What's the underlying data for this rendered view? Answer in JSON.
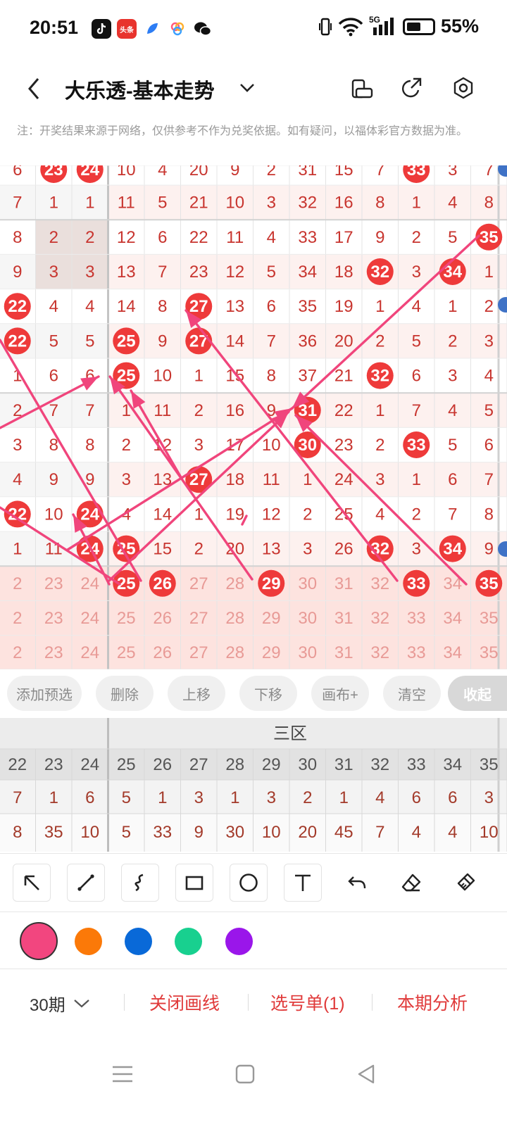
{
  "status": {
    "time": "20:51",
    "apps": [
      "douyin-icon",
      "toutiao-icon",
      "feather-icon",
      "gallery-icon",
      "wechat-icon"
    ],
    "toutiao_label": "头条",
    "network": "5G",
    "battery": "55%",
    "battery_level": 0.55
  },
  "header": {
    "title": "大乐透-基本走势",
    "icons": [
      "back-icon",
      "chevron-down-icon",
      "phone-rotate-icon",
      "share-icon",
      "settings-icon"
    ]
  },
  "notice": "注：开奖结果来源于网络，仅供参考不作为兑奖依据。如有疑问，以福体彩官方数据为准。",
  "chart": {
    "rows": [
      [
        "6",
        "23",
        "24",
        "10",
        "4",
        "20",
        "9",
        "2",
        "31",
        "15",
        "7",
        "33",
        "3",
        "7"
      ],
      [
        "7",
        "1",
        "1",
        "11",
        "5",
        "21",
        "10",
        "3",
        "32",
        "16",
        "8",
        "1",
        "4",
        "8"
      ],
      [
        "8",
        "2",
        "2",
        "12",
        "6",
        "22",
        "11",
        "4",
        "33",
        "17",
        "9",
        "2",
        "5",
        "35"
      ],
      [
        "9",
        "3",
        "3",
        "13",
        "7",
        "23",
        "12",
        "5",
        "34",
        "18",
        "32",
        "3",
        "34",
        "1"
      ],
      [
        "22",
        "4",
        "4",
        "14",
        "8",
        "27",
        "13",
        "6",
        "35",
        "19",
        "1",
        "4",
        "1",
        "2"
      ],
      [
        "22",
        "5",
        "5",
        "25",
        "9",
        "27",
        "14",
        "7",
        "36",
        "20",
        "2",
        "5",
        "2",
        "3"
      ],
      [
        "1",
        "6",
        "6",
        "25",
        "10",
        "1",
        "15",
        "8",
        "37",
        "21",
        "32",
        "6",
        "3",
        "4"
      ],
      [
        "2",
        "7",
        "7",
        "1",
        "11",
        "2",
        "16",
        "9",
        "31",
        "22",
        "1",
        "7",
        "4",
        "5"
      ],
      [
        "3",
        "8",
        "8",
        "2",
        "12",
        "3",
        "17",
        "10",
        "30",
        "23",
        "2",
        "33",
        "5",
        "6"
      ],
      [
        "4",
        "9",
        "9",
        "3",
        "13",
        "27",
        "18",
        "11",
        "1",
        "24",
        "3",
        "1",
        "6",
        "7"
      ],
      [
        "22",
        "10",
        "24",
        "4",
        "14",
        "1",
        "19",
        "12",
        "2",
        "25",
        "4",
        "2",
        "7",
        "8"
      ],
      [
        "1",
        "11",
        "24",
        "25",
        "15",
        "2",
        "20",
        "13",
        "3",
        "26",
        "32",
        "3",
        "34",
        "9"
      ],
      [
        "2",
        "23",
        "24",
        "25",
        "26",
        "27",
        "28",
        "29",
        "30",
        "31",
        "32",
        "33",
        "34",
        "35"
      ],
      [
        "2",
        "23",
        "24",
        "25",
        "26",
        "27",
        "28",
        "29",
        "30",
        "31",
        "32",
        "33",
        "34",
        "35"
      ],
      [
        "2",
        "23",
        "24",
        "25",
        "26",
        "27",
        "28",
        "29",
        "30",
        "31",
        "32",
        "33",
        "34",
        "35"
      ]
    ],
    "balls": [
      [
        0,
        1
      ],
      [
        0,
        2
      ],
      [
        0,
        11
      ],
      [
        2,
        13
      ],
      [
        3,
        10
      ],
      [
        3,
        12
      ],
      [
        4,
        0
      ],
      [
        4,
        5
      ],
      [
        5,
        0
      ],
      [
        5,
        3
      ],
      [
        5,
        5
      ],
      [
        6,
        3
      ],
      [
        6,
        10
      ],
      [
        7,
        8
      ],
      [
        8,
        8
      ],
      [
        8,
        11
      ],
      [
        9,
        5
      ],
      [
        10,
        0
      ],
      [
        10,
        2
      ],
      [
        11,
        2
      ],
      [
        11,
        3
      ],
      [
        11,
        10
      ],
      [
        11,
        12
      ],
      [
        12,
        3
      ],
      [
        12,
        4
      ],
      [
        12,
        7
      ],
      [
        12,
        11
      ],
      [
        12,
        13
      ]
    ],
    "ball_color": "#ee3a3a",
    "number_color": "#c8352f",
    "line_color": "#f0457c",
    "section_colors": {
      "missing_row": "#fde3df",
      "alt_row": "#f6f6f6"
    }
  },
  "actions": {
    "add": "添加预选",
    "delete": "删除",
    "move_up": "上移",
    "move_down": "下移",
    "canvas": "画布+",
    "clear": "清空",
    "collapse": "收起"
  },
  "stats": {
    "zone_label": "三区",
    "headers": [
      "22",
      "23",
      "24",
      "25",
      "26",
      "27",
      "28",
      "29",
      "30",
      "31",
      "32",
      "33",
      "34",
      "35"
    ],
    "row1": [
      "7",
      "1",
      "6",
      "5",
      "1",
      "3",
      "1",
      "3",
      "2",
      "1",
      "4",
      "6",
      "6",
      "3"
    ],
    "row2": [
      "8",
      "35",
      "10",
      "5",
      "33",
      "9",
      "30",
      "10",
      "20",
      "45",
      "7",
      "4",
      "4",
      "10"
    ]
  },
  "tools": [
    "arrow-tool-icon",
    "line-tool-icon",
    "freehand-tool-icon",
    "rectangle-tool-icon",
    "circle-tool-icon",
    "text-tool-icon",
    "undo-icon",
    "eraser-icon",
    "clear-brush-icon"
  ],
  "colors": [
    "#f2467f",
    "#fb7908",
    "#0969d8",
    "#18d08f",
    "#9a16ea"
  ],
  "bottom": {
    "period": "30期",
    "close_lines": "关闭画线",
    "picks": "选号单(1)",
    "analysis": "本期分析"
  },
  "nav": [
    "menu-icon",
    "home-icon",
    "back-nav-icon"
  ]
}
